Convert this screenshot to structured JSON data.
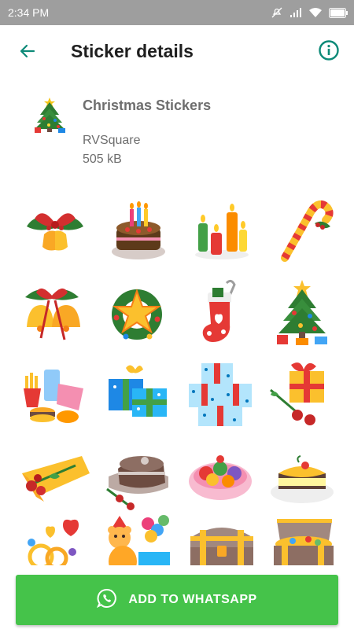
{
  "status_bar": {
    "time": "2:34 PM"
  },
  "app_bar": {
    "title": "Sticker details",
    "back_icon": "arrow-back-icon",
    "info_icon": "info-icon"
  },
  "pack": {
    "name": "Christmas Stickers",
    "author": "RVSquare",
    "size": "505 kB",
    "tray_icon": "christmas-tree-icon"
  },
  "stickers": [
    "holly-bells-bow",
    "birthday-cake",
    "candles",
    "candy-cane",
    "christmas-bells",
    "star-wreath",
    "christmas-stocking",
    "christmas-tree",
    "fast-food",
    "gift-boxes-blue",
    "gift-boxes-polka",
    "gift-with-roses",
    "roses-bouquet",
    "chocolate-cake",
    "fruit-bowl",
    "cheesecake",
    "rings-and-hearts",
    "teddy-bear-balloons",
    "treasure-chest-closed",
    "treasure-chest-open"
  ],
  "colors": {
    "accent": "#0d8a78",
    "button": "#45c34a",
    "status_bar": "#9e9e9e"
  },
  "add_button": {
    "label": "ADD TO WHATSAPP",
    "icon": "whatsapp-icon"
  }
}
